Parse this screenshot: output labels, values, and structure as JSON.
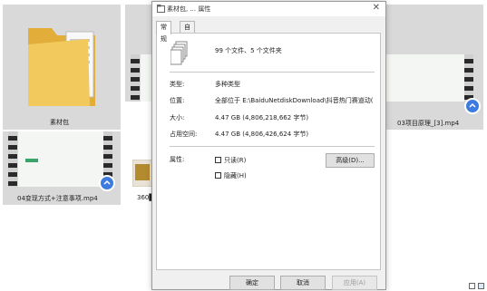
{
  "background_tiles": {
    "folder_label": "素材包",
    "tile2_label": "03项目原理_[3].mp4",
    "tile3_label": "04变现方式+注意事项.mp4",
    "tile4_label": "360█"
  },
  "dialog": {
    "title": "素材包, ... 属性",
    "tabs": [
      "常规",
      "自定义"
    ],
    "summary": "99 个文件、5 个文件夹",
    "type_label": "类型:",
    "type_value": "多种类型",
    "location_label": "位置:",
    "location_value": "全部位于 E:\\BaiduNetdiskDownload\\抖音热门赛道动(",
    "size_label": "大小:",
    "size_value": "4.47 GB (4,806,218,662 字节)",
    "disk_label": "占用空间:",
    "disk_value": "4.47 GB (4,806,426,624 字节)",
    "attr_label": "属性:",
    "readonly_label": "只读(R)",
    "hidden_label": "隐藏(H)",
    "advanced_button": "高级(D)...",
    "ok_button": "确定",
    "cancel_button": "取消",
    "apply_button": "应用(A)"
  },
  "colors": {
    "accent": "#3d7be0",
    "folder": "#e9bd4f"
  }
}
